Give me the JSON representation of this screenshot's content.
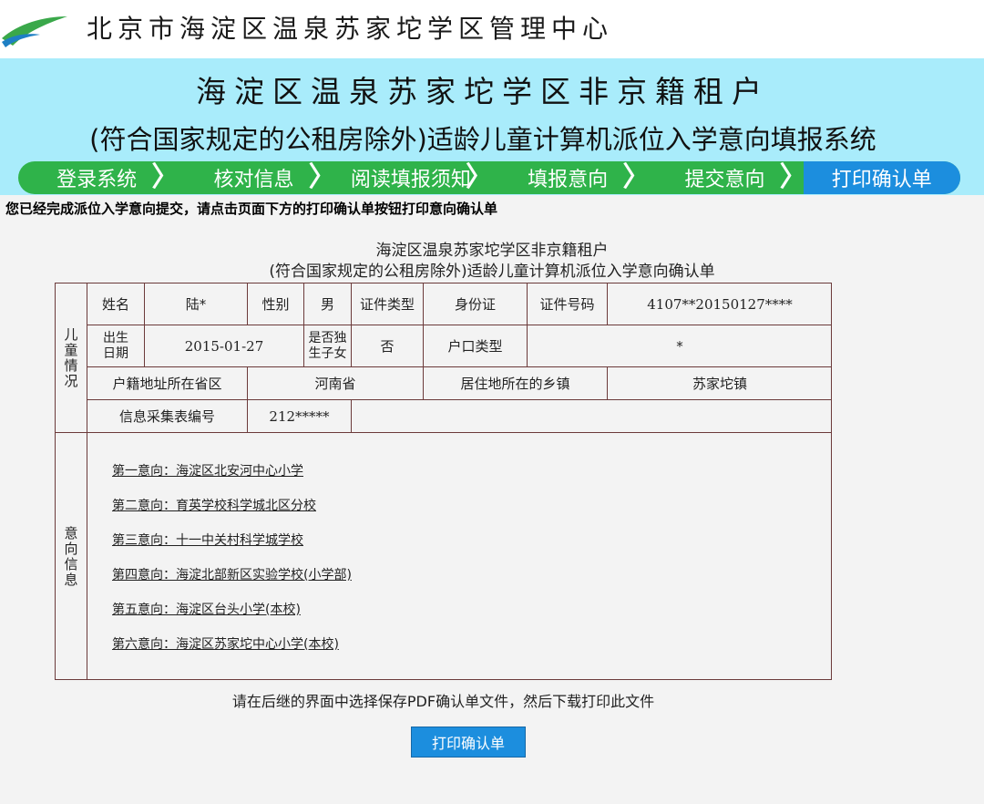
{
  "header": {
    "org_title": "北京市海淀区温泉苏家坨学区管理中心",
    "system_title_line1": "海淀区温泉苏家坨学区非京籍租户",
    "system_title_line2": "(符合国家规定的公租房除外)适龄儿童计算机派位入学意向填报系统"
  },
  "steps": [
    {
      "label": "登录系统",
      "active": false
    },
    {
      "label": "核对信息",
      "active": false
    },
    {
      "label": "阅读填报须知",
      "active": false
    },
    {
      "label": "填报意向",
      "active": false
    },
    {
      "label": "提交意向",
      "active": false
    },
    {
      "label": "打印确认单",
      "active": true
    }
  ],
  "notice": "您已经完成派位入学意向提交，请点击页面下方的打印确认单按钮打印意向确认单",
  "doc": {
    "title1": "海淀区温泉苏家坨学区非京籍租户",
    "title2": "(符合国家规定的公租房除外)适龄儿童计算机派位入学意向确认单",
    "section_child": "儿童情况",
    "section_intent": "意向信息",
    "labels": {
      "name": "姓名",
      "gender": "性别",
      "id_type": "证件类型",
      "id_number": "证件号码",
      "birth_date": "出生日期",
      "only_child": "是否独生子女",
      "hukou_type": "户口类型",
      "hukou_province": "户籍地址所在省区",
      "residence_town": "居住地所在的乡镇",
      "form_number": "信息采集表编号"
    },
    "values": {
      "name": "陆*",
      "gender": "男",
      "id_type": "身份证",
      "id_number": "4107**20150127****",
      "birth_date": "2015-01-27",
      "only_child": "否",
      "hukou_type": "*",
      "hukou_province": "河南省",
      "residence_town": "苏家坨镇",
      "form_number": "212*****"
    },
    "intents": [
      "第一意向：海淀区北安河中心小学",
      "第二意向：育英学校科学城北区分校",
      "第三意向：十一中关村科学城学校",
      "第四意向：海淀北部新区实验学校(小学部)",
      "第五意向：海淀区台头小学(本校)",
      "第六意向：海淀区苏家坨中心小学(本校)"
    ]
  },
  "hint": "请在后继的界面中选择保存PDF确认单文件，然后下载打印此文件",
  "print_button": "打印确认单",
  "colors": {
    "banner_bg": "#a9ecfb",
    "steps_green": "#2fb34a",
    "steps_active_blue": "#1c8ede",
    "table_border": "#6b3a3a",
    "button_blue": "#1c8ede"
  }
}
